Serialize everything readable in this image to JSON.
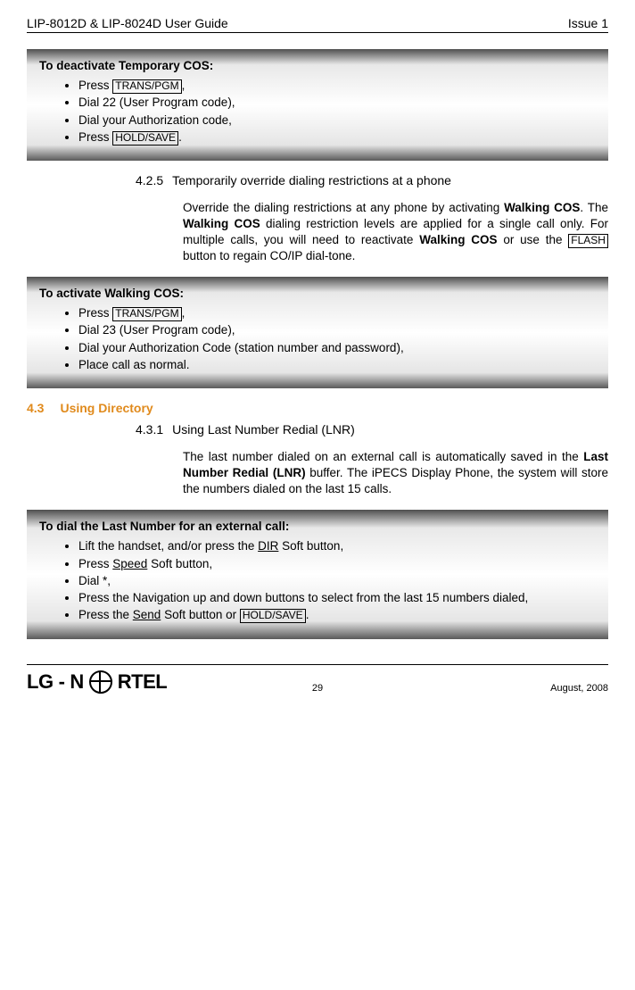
{
  "header": {
    "left": "LIP-8012D & LIP-8024D User Guide",
    "right": "Issue 1"
  },
  "box1": {
    "title": "To deactivate Temporary COS:",
    "items": {
      "i0a": "Press ",
      "i0key": "TRANS/PGM",
      "i0b": ",",
      "i1": "Dial 22 (User Program code),",
      "i2": "Dial your Authorization code,",
      "i3a": "Press ",
      "i3key": "HOLD/SAVE",
      "i3b": "."
    }
  },
  "sub425": {
    "num": "4.2.5",
    "title": "Temporarily override dialing restrictions at a phone",
    "p1a": "Override the dialing restrictions at any phone by activating ",
    "p1b": "Walking COS",
    "p1c": ".  The ",
    "p1d": "Walking COS",
    "p1e": " dialing restriction levels are applied for a single call only.  For multiple calls, you will need to reactivate ",
    "p1f": "Walking COS",
    "p1g": " or use the ",
    "p1key": "FLASH",
    "p1h": " button to regain CO/IP dial-tone."
  },
  "box2": {
    "title": "To activate Walking COS:",
    "items": {
      "i0a": "Press ",
      "i0key": "TRANS/PGM",
      "i0b": ",",
      "i1": "Dial 23 (User Program code),",
      "i2": "Dial your Authorization Code (station number and password),",
      "i3": "Place call as normal."
    }
  },
  "section43": {
    "num": "4.3",
    "title": "Using Directory"
  },
  "sub431": {
    "num": "4.3.1",
    "title": "Using Last Number Redial (LNR)",
    "p1a": "The last number dialed on an external call is automatically saved in the ",
    "p1b": "Last Number Redial (LNR)",
    "p1c": " buffer.  The iPECS Display Phone, the system will store the numbers dialed on the last 15 calls."
  },
  "box3": {
    "title": "To dial the Last Number for an external call:",
    "items": {
      "i0a": "Lift the handset, and/or press the ",
      "i0u": "DIR",
      "i0b": " Soft button,",
      "i1a": "Press ",
      "i1u": "Speed",
      "i1b": " Soft button,",
      "i2": "Dial *,",
      "i3": "Press the Navigation up and down buttons to select from the last 15 numbers dialed,",
      "i4a": "Press the ",
      "i4u": "Send",
      "i4b": " Soft button or ",
      "i4key": "HOLD/SAVE",
      "i4c": "."
    }
  },
  "footer": {
    "logo1": "LG",
    "logo2": "N",
    "logo3": "RTEL",
    "page": "29",
    "date": "August, 2008"
  }
}
